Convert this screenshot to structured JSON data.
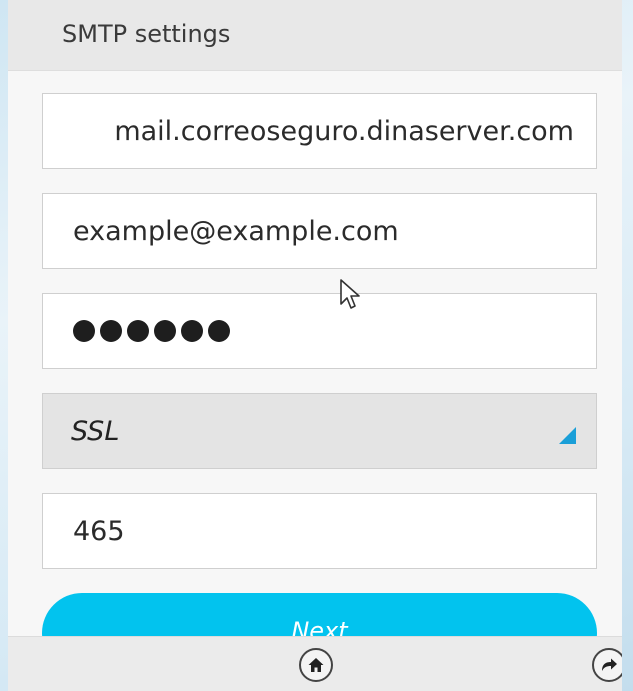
{
  "header": {
    "title": "SMTP settings"
  },
  "form": {
    "server_value": "mail.correoseguro.dinaserver.com",
    "email_value": "example@example.com",
    "password_value": "●●●●●●",
    "security_selected": "SSL",
    "port_value": "465"
  },
  "buttons": {
    "next_label": "Next"
  },
  "footer": {
    "home_icon": "home-icon",
    "forward_icon": "forward-icon"
  },
  "colors": {
    "accent": "#02c3ee",
    "arrow": "#1a9fd8",
    "header_bg": "#e8e8e8"
  }
}
